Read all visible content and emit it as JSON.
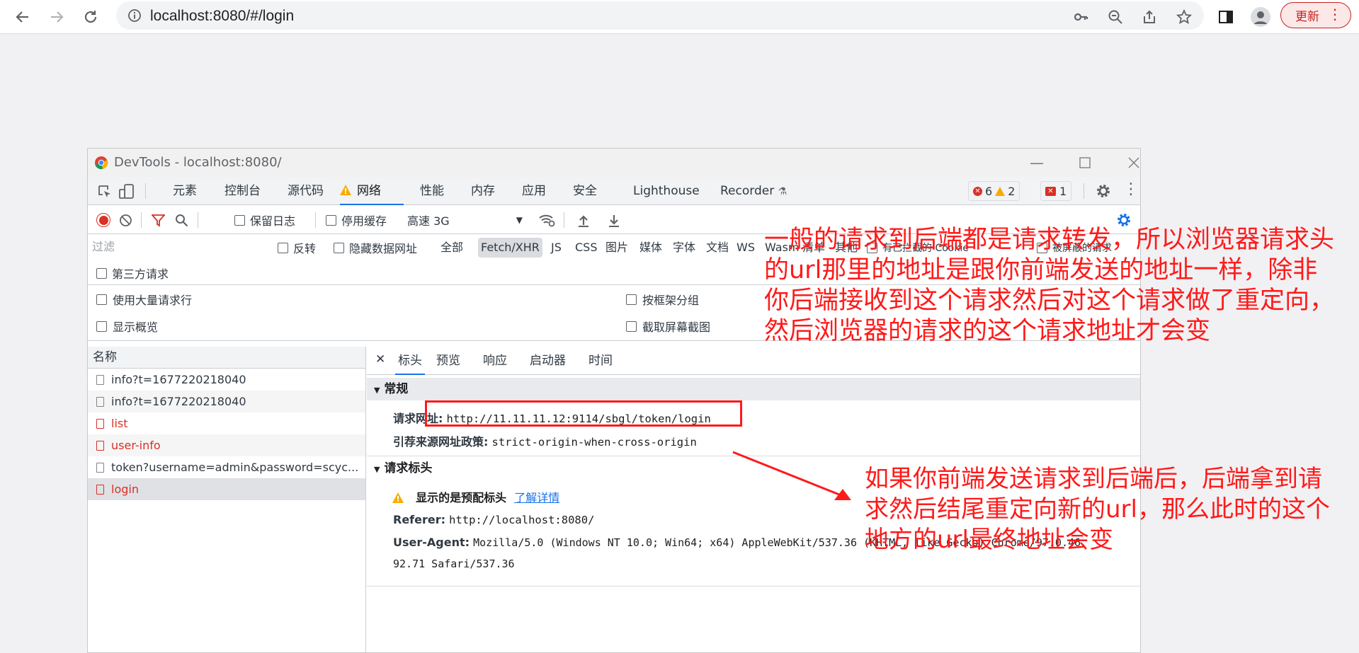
{
  "browser": {
    "url": "localhost:8080/#/login",
    "update_label": "更新"
  },
  "devtools": {
    "title": "DevTools - localhost:8080/",
    "tabs": [
      "元素",
      "控制台",
      "源代码",
      "网络",
      "性能",
      "内存",
      "应用",
      "安全",
      "Lighthouse",
      "Recorder"
    ],
    "badges": {
      "errors": "6",
      "warnings": "2",
      "issues": "1"
    },
    "toolbar": {
      "preserve_log": "保留日志",
      "disable_cache": "停用缓存",
      "throttle": "高速 3G"
    },
    "filter": {
      "placeholder": "过滤",
      "invert": "反转",
      "hide_data_urls": "隐藏数据网址",
      "types": [
        "全部",
        "Fetch/XHR",
        "JS",
        "CSS",
        "图片",
        "媒体",
        "字体",
        "文档",
        "WS",
        "Wasm",
        "清单",
        "其他"
      ],
      "selected_type": "Fetch/XHR",
      "blocked_cookies": "有已拦截的 Cookie",
      "blocked_requests": "被屏蔽的请求",
      "third_party": "第三方请求"
    },
    "options": {
      "large_rows": "使用大量请求行",
      "group_by_frame": "按框架分组",
      "show_overview": "显示概览",
      "capture_screenshots": "截取屏幕截图"
    },
    "request_list": {
      "header": "名称",
      "rows": [
        {
          "name": "info?t=1677220218040",
          "status": "ok"
        },
        {
          "name": "info?t=1677220218040",
          "status": "ok"
        },
        {
          "name": "list",
          "status": "error"
        },
        {
          "name": "user-info",
          "status": "error"
        },
        {
          "name": "token?username=admin&password=scyc...",
          "status": "ok"
        },
        {
          "name": "login",
          "status": "error"
        }
      ]
    },
    "detail": {
      "tabs": [
        "标头",
        "预览",
        "响应",
        "启动器",
        "时间"
      ],
      "general": {
        "title": "常规",
        "request_url_label": "请求网址:",
        "request_url": "http://11.11.11.12:9114/sbgl/token/login",
        "referrer_policy_label": "引荐来源网址政策:",
        "referrer_policy": "strict-origin-when-cross-origin"
      },
      "request_headers": {
        "title": "请求标头",
        "provisional_warning": "显示的是预配标头",
        "learn_more": "了解详情",
        "referer_label": "Referer:",
        "referer": "http://localhost:8080/",
        "ua_label": "User-Agent:",
        "ua_line1": "Mozilla/5.0 (Windows NT 10.0; Win64; x64) AppleWebKit/537.36 (KHTML, like Gecko) Chrome/97.0.46",
        "ua_line2": "92.71 Safari/537.36"
      }
    }
  },
  "annotations": {
    "note1": [
      "一般的请求到后端都是请求转发，所以浏览器请求头",
      "的url那里的地址是跟你前端发送的地址一样，除非",
      "你后端接收到这个请求然后对这个请求做了重定向，",
      "然后浏览器的请求的这个请求地址才会变"
    ],
    "note2": [
      "如果你前端发送请求到后端后，后端拿到请",
      "求然后结尾重定向新的url，那么此时的这个",
      "地方的url最终地址会变"
    ]
  },
  "colors": {
    "annotation": "#ff1a1a",
    "accent": "#1a73e8",
    "error": "#d93025"
  }
}
